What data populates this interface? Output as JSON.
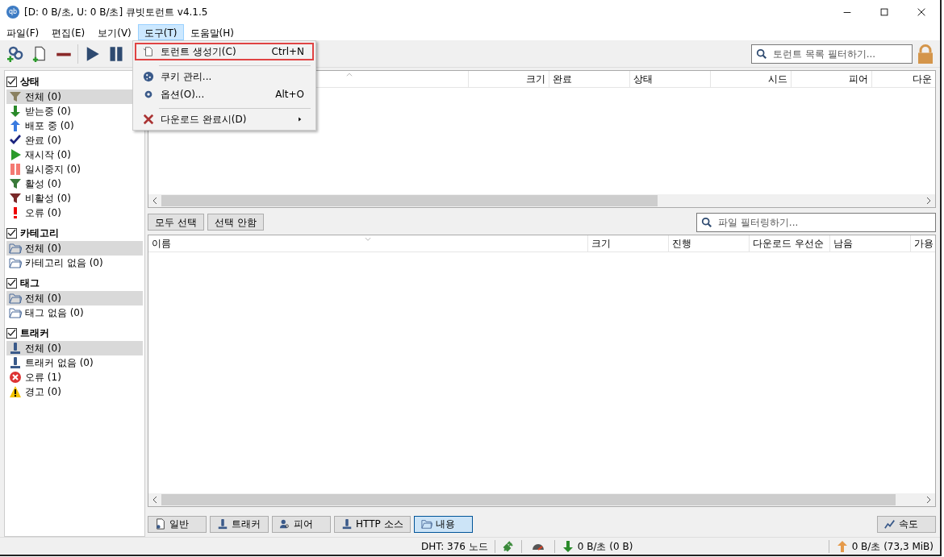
{
  "window": {
    "logo": "qb",
    "title": "[D: 0 B/초, U: 0 B/초] 큐빗토런트 v4.1.5"
  },
  "menus": [
    {
      "label": "파일(F)",
      "selected": false
    },
    {
      "label": "편집(E)",
      "selected": false
    },
    {
      "label": "보기(V)",
      "selected": false
    },
    {
      "label": "도구(T)",
      "selected": true
    },
    {
      "label": "도움말(H)",
      "selected": false
    }
  ],
  "dropdown": [
    {
      "label": "토런트 생성기(C)",
      "shortcut": "Ctrl+N",
      "highlighted": true,
      "separator_before": false,
      "submenu": false
    },
    {
      "label": "쿠키 관리...",
      "highlighted": false,
      "separator_before": true,
      "submenu": false
    },
    {
      "label": "옵션(O)...",
      "shortcut": "Alt+O",
      "highlighted": false,
      "separator_before": false,
      "submenu": false
    },
    {
      "label": "다운로드 완료시(D)",
      "highlighted": false,
      "separator_before": true,
      "submenu": true
    }
  ],
  "search": {
    "placeholder": "토런트 목록 필터하기..."
  },
  "sidebar": [
    {
      "title": "상태",
      "checked": true,
      "items": [
        {
          "label": "전체 (0)",
          "selected": true
        },
        {
          "label": "받는중 (0)",
          "selected": false
        },
        {
          "label": "배포 중 (0)",
          "selected": false
        },
        {
          "label": "완료 (0)",
          "selected": false
        },
        {
          "label": "재시작 (0)",
          "selected": false
        },
        {
          "label": "일시중지 (0)",
          "selected": false
        },
        {
          "label": "활성 (0)",
          "selected": false
        },
        {
          "label": "비활성 (0)",
          "selected": false
        },
        {
          "label": "오류 (0)",
          "selected": false
        }
      ]
    },
    {
      "title": "카테고리",
      "checked": true,
      "items": [
        {
          "label": "전체 (0)",
          "selected": true
        },
        {
          "label": "카테고리 없음 (0)",
          "selected": false
        }
      ]
    },
    {
      "title": "태그",
      "checked": true,
      "items": [
        {
          "label": "전체 (0)",
          "selected": true
        },
        {
          "label": "태그 없음 (0)",
          "selected": false
        }
      ]
    },
    {
      "title": "트래커",
      "checked": true,
      "items": [
        {
          "label": "전체 (0)",
          "selected": true
        },
        {
          "label": "트래커 없음 (0)",
          "selected": false
        },
        {
          "label": "오류 (1)",
          "selected": false
        },
        {
          "label": "경고 (0)",
          "selected": false
        }
      ]
    }
  ],
  "torrent_table": {
    "columns": [
      "크기",
      "완료",
      "상태",
      "시드",
      "피어",
      "다운"
    ]
  },
  "file_buttons": [
    "모두 선택",
    "선택 안함"
  ],
  "file_search": {
    "placeholder": "파일 필터링하기..."
  },
  "file_table": {
    "columns": [
      "이름",
      "크기",
      "진행",
      "다운로드 우선순",
      "남음",
      "가용"
    ]
  },
  "tabs": [
    {
      "label": "일반",
      "selected": false
    },
    {
      "label": "트래커",
      "selected": false
    },
    {
      "label": "피어",
      "selected": false
    },
    {
      "label": "HTTP 소스",
      "selected": false
    },
    {
      "label": "내용",
      "selected": true
    }
  ],
  "speed_button": "속도",
  "status_bar": {
    "dht": "DHT: 376 노드",
    "download": "0 B/초 (0 B)",
    "upload": "0 B/초 (73,3 MiB)"
  }
}
